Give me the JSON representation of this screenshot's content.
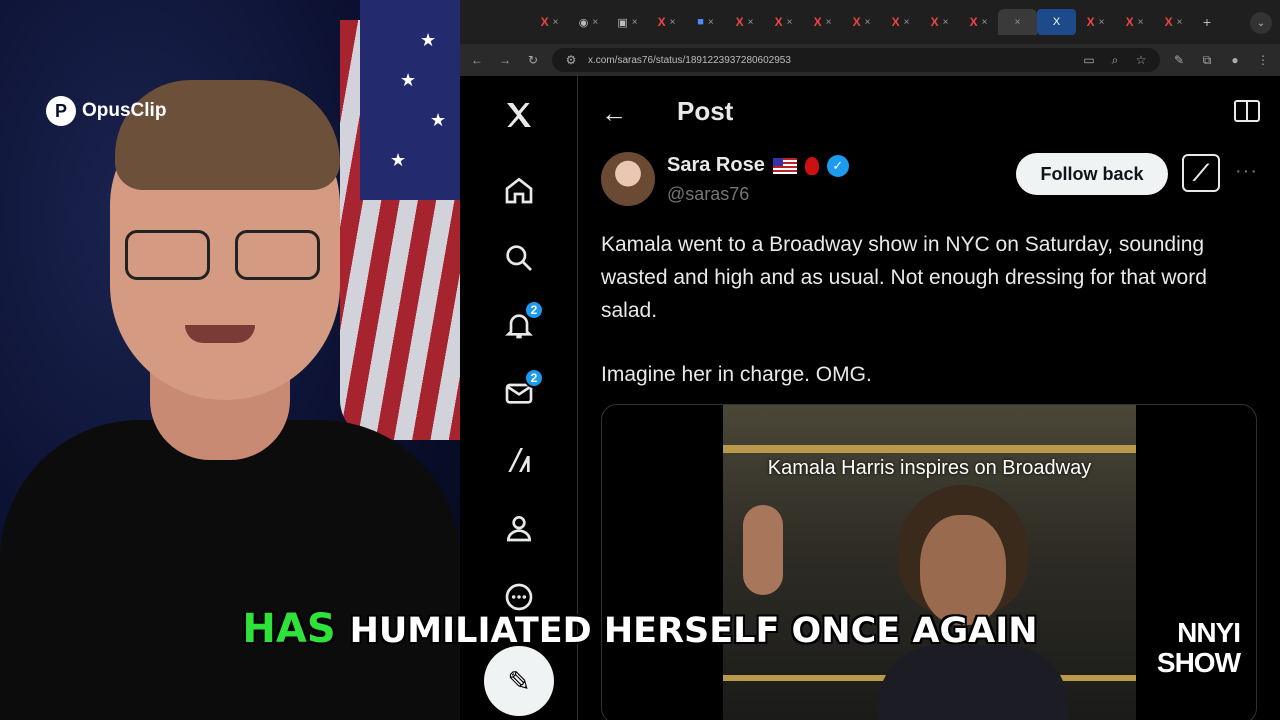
{
  "overlay": {
    "brand": "OpusClip",
    "caption_highlight": "HAS",
    "caption_rest": "HUMILIATED HERSELF ONCE AGAIN"
  },
  "browser": {
    "url": "x.com/saras76/status/1891223937280602953",
    "tab_count": 17
  },
  "x_nav": {
    "notifications_badge": "2",
    "messages_badge": "2"
  },
  "post": {
    "header_title": "Post",
    "author_name": "Sara Rose",
    "author_handle": "@saras76",
    "follow_label": "Follow back",
    "more_label": "···",
    "text_paragraph_1": "Kamala went to a Broadway show in NYC on Saturday, sounding wasted and high and as usual. Not enough dressing for that word salad.",
    "text_paragraph_2": "Imagine her in charge. OMG.",
    "video_caption": "Kamala Harris inspires on Broadway",
    "video_logo": "NNYI SHOW"
  },
  "colors": {
    "accent_blue": "#1d9bf0",
    "caption_green": "#2ee23a",
    "background": "#000000"
  }
}
